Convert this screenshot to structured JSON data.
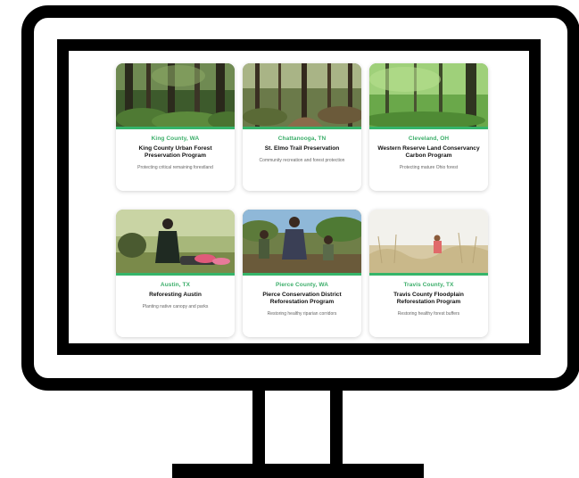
{
  "cards": [
    {
      "location": "King County, WA",
      "title": "King County Urban Forest Preservation Program",
      "description": "Protecting critical remaining forestland",
      "image": "dense-forest-photo"
    },
    {
      "location": "Chattanooga, TN",
      "title": "St. Elmo Trail Preservation",
      "description": "Community recreation and forest protection",
      "image": "forest-trail-photo"
    },
    {
      "location": "Cleveland, OH",
      "title": "Western Reserve Land Conservancy Carbon Program",
      "description": "Protecting mature Ohio forest",
      "image": "ohio-forest-photo"
    },
    {
      "location": "Austin, TX",
      "title": "Reforesting Austin",
      "description": "Planting native canopy and parks",
      "image": "volunteers-planting-photo"
    },
    {
      "location": "Pierce County, WA",
      "title": "Pierce Conservation District Reforestation Program",
      "description": "Restoring healthy riparian corridors",
      "image": "group-planting-photo"
    },
    {
      "location": "Travis County, TX",
      "title": "Travis County Floodplain Reforestation Program",
      "description": "Restoring healthy forest buffers",
      "image": "floodplain-grass-photo"
    }
  ],
  "colors": {
    "accent": "#35b56a",
    "location_text": "#3cae6a",
    "frame": "#000000"
  }
}
